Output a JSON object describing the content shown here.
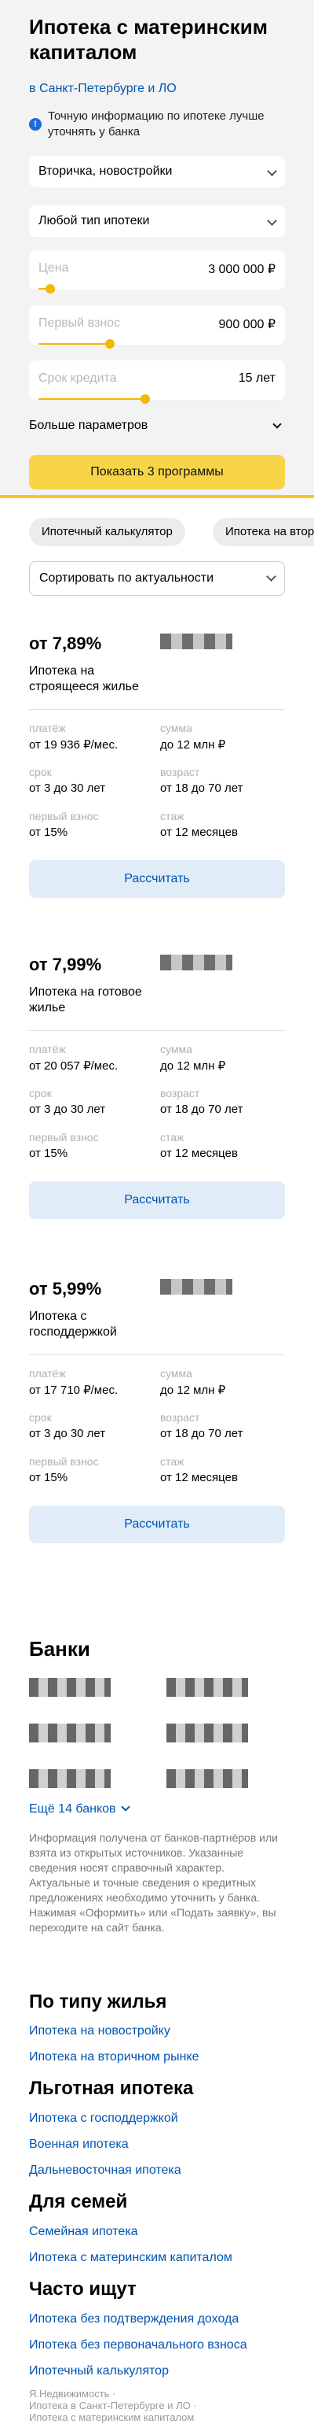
{
  "header": {
    "title": "Ипотека с материнским капиталом",
    "region_link": "в Санкт-Петербурге и ЛО",
    "info_icon": "info-icon",
    "info_text": "Точную информацию по ипотеке лучше уточнять у банка"
  },
  "filters": {
    "property_type": "Вторичка, новостройки",
    "mortgage_type": "Любой тип ипотеки",
    "price": {
      "label": "Цена",
      "value": "3 000 000 ₽",
      "level": 0.05
    },
    "down_payment": {
      "label": "Первый взнос",
      "value": "900 000 ₽",
      "level": 0.3
    },
    "term": {
      "label": "Срок кредита",
      "value": "15 лет",
      "level": 0.45
    },
    "more_params": "Больше параметров",
    "show_button": "Показать 3 программы"
  },
  "chips": [
    "Ипотечный калькулятор",
    "Ипотека на вторичное жильё"
  ],
  "sort": {
    "value": "Сортировать по актуальности"
  },
  "param_labels": {
    "payment": "платёж",
    "amount": "сумма",
    "term": "срок",
    "age": "возраст",
    "down": "первый взнос",
    "experience": "стаж"
  },
  "programs": [
    {
      "rate": "от 7,89%",
      "name": "Ипотека на строящееся жилье",
      "payment": "от 19 936 ₽/мес.",
      "amount": "до 12 млн ₽",
      "term": "от 3 до 30 лет",
      "age": "от 18 до 70 лет",
      "down": "от 15%",
      "experience": "от 12 месяцев",
      "button": "Рассчитать"
    },
    {
      "rate": "от 7,99%",
      "name": "Ипотека на готовое жилье",
      "payment": "от 20 057 ₽/мес.",
      "amount": "до 12 млн ₽",
      "term": "от 3 до 30 лет",
      "age": "от 18 до 70 лет",
      "down": "от 15%",
      "experience": "от 12 месяцев",
      "button": "Рассчитать"
    },
    {
      "rate": "от 5,99%",
      "name": "Ипотека с господдержкой",
      "payment": "от 17 710 ₽/мес.",
      "amount": "до 12 млн ₽",
      "term": "от 3 до 30 лет",
      "age": "от 18 до 70 лет",
      "down": "от 15%",
      "experience": "от 12 месяцев",
      "button": "Рассчитать"
    }
  ],
  "banks": {
    "title": "Банки",
    "more": "Ещё 14 банков",
    "disclaimer": "Информация получена от банков-партнёров или взята из открытых источников. Указанные сведения носят справочный характер. Актуальные и точные сведения о кредитных предложениях необходимо уточнить у банка. Нажимая «Оформить» или «Подать заявку», вы переходите на сайт банка."
  },
  "sections": [
    {
      "title": "По типу жилья",
      "links": [
        "Ипотека на новостройку",
        "Ипотека на вторичном рынке"
      ]
    },
    {
      "title": "Льготная ипотека",
      "links": [
        "Ипотека с господдержкой",
        "Военная ипотека",
        "Дальневосточная ипотека"
      ]
    },
    {
      "title": "Для семей",
      "links": [
        "Семейная ипотека",
        "Ипотека с материнским капиталом"
      ]
    },
    {
      "title": "Часто ищут",
      "links": [
        "Ипотека без подтверждения дохода",
        "Ипотека без первоначального взноса",
        "Ипотечный калькулятор"
      ]
    }
  ],
  "breadcrumbs": [
    "Я.Недвижимость ·",
    "Ипотека в Санкт-Петербурге и ЛО ·",
    "Ипотека с материнским капиталом"
  ]
}
